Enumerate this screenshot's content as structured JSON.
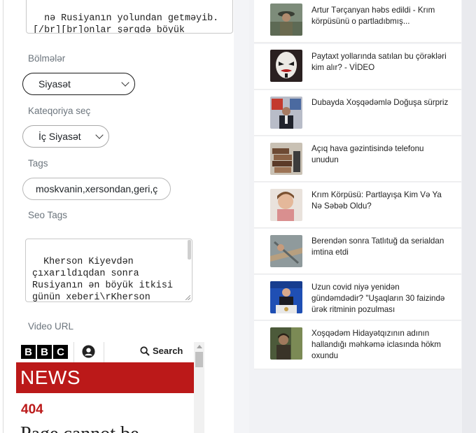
{
  "form": {
    "top_textarea": "nə Rusiyanın yolundan getməyib.\n[/br][br]onlar şərqdə böyük",
    "sections_label": "Bölmələr",
    "sections_value": "Siyasət",
    "category_label": "Kateqoriya seç",
    "category_value": "İç Siyasət",
    "tags_label": "Tags",
    "tags_value": "moskvanin,xersondan,geri,ç",
    "seo_label": "Seo Tags",
    "seo_value": "Kherson Kiyevdən\nçıxarıldıqdan sonra\nRusiyanın ən böyük itkisi\ngünün xeberi\\rKherson\nKiyevdən çıxarıldıqdan",
    "video_label": "Video URL"
  },
  "embed": {
    "logo_letters": [
      "B",
      "B",
      "C"
    ],
    "search_label": "Search",
    "news_label": "NEWS",
    "error_code": "404",
    "error_title": "Page cannot be"
  },
  "news": [
    {
      "title": "Artur Tərçanyan həbs edildi - Krım körpüsünü o partladıbmış...",
      "thumb": "soldier-photo"
    },
    {
      "title": "Paytaxt yollarında satılan bu çörəkləri kim alır? - VİDEO",
      "thumb": "mask-photo"
    },
    {
      "title": "Dubayda Xoşqədəmlə Doğuşa sürpriz",
      "thumb": "studio-photo"
    },
    {
      "title": "Açıq hava gəzintisində telefonu unudun",
      "thumb": "stack-photo"
    },
    {
      "title": "Krım Körpüsü: Partlayışa Kim Və Ya Nə Səbəb Oldu?",
      "thumb": "child-photo"
    },
    {
      "title": "Berendən sonra Tatlıtuğ da serialdan imtina etdi",
      "thumb": "hands-photo"
    },
    {
      "title": "Uzun covid niyə yenidən gündəmdədir? \"Uşaqların 30 faizində ürək ritminin pozulması",
      "thumb": "speaker-photo"
    },
    {
      "title": "Xoşqədəm Hidayətqızının adının hallandığı məhkəmə iclasında hökm oxundu",
      "thumb": "forest-photo"
    }
  ],
  "colors": {
    "bbc_red": "#bb1919",
    "panel_bg": "#f1f2f5",
    "label_gray": "#6c757d"
  }
}
